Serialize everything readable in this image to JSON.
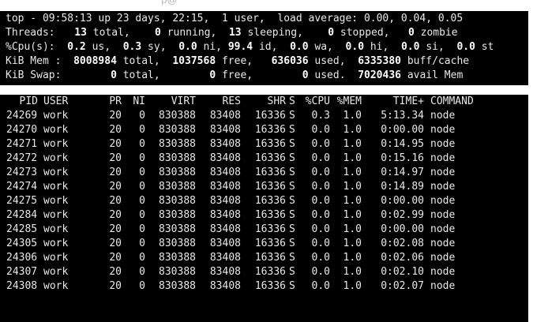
{
  "window": {
    "cut_text": "                                                        p@"
  },
  "summary": {
    "line1": "top - 09:58:13 up 23 days, 22:15,  1 user,  load average: 0.00, 0.04, 0.05",
    "threads": {
      "label": "Threads:",
      "total": "13",
      "total_l": "total,",
      "running": "0",
      "running_l": "running,",
      "sleeping": "13",
      "sleeping_l": "sleeping,",
      "stopped": "0",
      "stopped_l": "stopped,",
      "zombie": "0",
      "zombie_l": "zombie"
    },
    "cpu": {
      "label": "%Cpu(s):",
      "us": "0.2",
      "us_l": "us,",
      "sy": "0.3",
      "sy_l": "sy,",
      "ni": "0.0",
      "ni_l": "ni,",
      "id": "99.4",
      "id_l": "id,",
      "wa": "0.0",
      "wa_l": "wa,",
      "hi": "0.0",
      "hi_l": "hi,",
      "si": "0.0",
      "si_l": "si,",
      "st": "0.0",
      "st_l": "st"
    },
    "mem": {
      "label": "KiB Mem :",
      "total": "8008984",
      "total_l": "total,",
      "free": "1037568",
      "free_l": "free,",
      "used": "636036",
      "used_l": "used,",
      "buff": "6335380",
      "buff_l": "buff/cache"
    },
    "swap": {
      "label": "KiB Swap:",
      "total": "0",
      "total_l": "total,",
      "free": "0",
      "free_l": "free,",
      "used": "0",
      "used_l": "used.",
      "avail": "7020436",
      "avail_l": "avail Mem"
    }
  },
  "table": {
    "columns": {
      "pid": "PID",
      "user": "USER",
      "pr": "PR",
      "ni": "NI",
      "virt": "VIRT",
      "res": "RES",
      "shr": "SHR",
      "s": "S",
      "cpu": "%CPU",
      "mem": "%MEM",
      "time": "TIME+",
      "command": "COMMAND"
    },
    "rows": [
      {
        "pid": "24269",
        "user": "work",
        "pr": "20",
        "ni": "0",
        "virt": "830388",
        "res": "83408",
        "shr": "16336",
        "s": "S",
        "cpu": "0.3",
        "mem": "1.0",
        "time": "5:13.34",
        "command": "node"
      },
      {
        "pid": "24270",
        "user": "work",
        "pr": "20",
        "ni": "0",
        "virt": "830388",
        "res": "83408",
        "shr": "16336",
        "s": "S",
        "cpu": "0.0",
        "mem": "1.0",
        "time": "0:00.00",
        "command": "node"
      },
      {
        "pid": "24271",
        "user": "work",
        "pr": "20",
        "ni": "0",
        "virt": "830388",
        "res": "83408",
        "shr": "16336",
        "s": "S",
        "cpu": "0.0",
        "mem": "1.0",
        "time": "0:14.95",
        "command": "node"
      },
      {
        "pid": "24272",
        "user": "work",
        "pr": "20",
        "ni": "0",
        "virt": "830388",
        "res": "83408",
        "shr": "16336",
        "s": "S",
        "cpu": "0.0",
        "mem": "1.0",
        "time": "0:15.16",
        "command": "node"
      },
      {
        "pid": "24273",
        "user": "work",
        "pr": "20",
        "ni": "0",
        "virt": "830388",
        "res": "83408",
        "shr": "16336",
        "s": "S",
        "cpu": "0.0",
        "mem": "1.0",
        "time": "0:14.97",
        "command": "node"
      },
      {
        "pid": "24274",
        "user": "work",
        "pr": "20",
        "ni": "0",
        "virt": "830388",
        "res": "83408",
        "shr": "16336",
        "s": "S",
        "cpu": "0.0",
        "mem": "1.0",
        "time": "0:14.89",
        "command": "node"
      },
      {
        "pid": "24275",
        "user": "work",
        "pr": "20",
        "ni": "0",
        "virt": "830388",
        "res": "83408",
        "shr": "16336",
        "s": "S",
        "cpu": "0.0",
        "mem": "1.0",
        "time": "0:00.00",
        "command": "node"
      },
      {
        "pid": "24284",
        "user": "work",
        "pr": "20",
        "ni": "0",
        "virt": "830388",
        "res": "83408",
        "shr": "16336",
        "s": "S",
        "cpu": "0.0",
        "mem": "1.0",
        "time": "0:02.99",
        "command": "node"
      },
      {
        "pid": "24285",
        "user": "work",
        "pr": "20",
        "ni": "0",
        "virt": "830388",
        "res": "83408",
        "shr": "16336",
        "s": "S",
        "cpu": "0.0",
        "mem": "1.0",
        "time": "0:00.00",
        "command": "node"
      },
      {
        "pid": "24305",
        "user": "work",
        "pr": "20",
        "ni": "0",
        "virt": "830388",
        "res": "83408",
        "shr": "16336",
        "s": "S",
        "cpu": "0.0",
        "mem": "1.0",
        "time": "0:02.08",
        "command": "node"
      },
      {
        "pid": "24306",
        "user": "work",
        "pr": "20",
        "ni": "0",
        "virt": "830388",
        "res": "83408",
        "shr": "16336",
        "s": "S",
        "cpu": "0.0",
        "mem": "1.0",
        "time": "0:02.06",
        "command": "node"
      },
      {
        "pid": "24307",
        "user": "work",
        "pr": "20",
        "ni": "0",
        "virt": "830388",
        "res": "83408",
        "shr": "16336",
        "s": "S",
        "cpu": "0.0",
        "mem": "1.0",
        "time": "0:02.10",
        "command": "node"
      },
      {
        "pid": "24308",
        "user": "work",
        "pr": "20",
        "ni": "0",
        "virt": "830388",
        "res": "83408",
        "shr": "16336",
        "s": "S",
        "cpu": "0.0",
        "mem": "1.0",
        "time": "0:02.07",
        "command": "node"
      }
    ]
  }
}
